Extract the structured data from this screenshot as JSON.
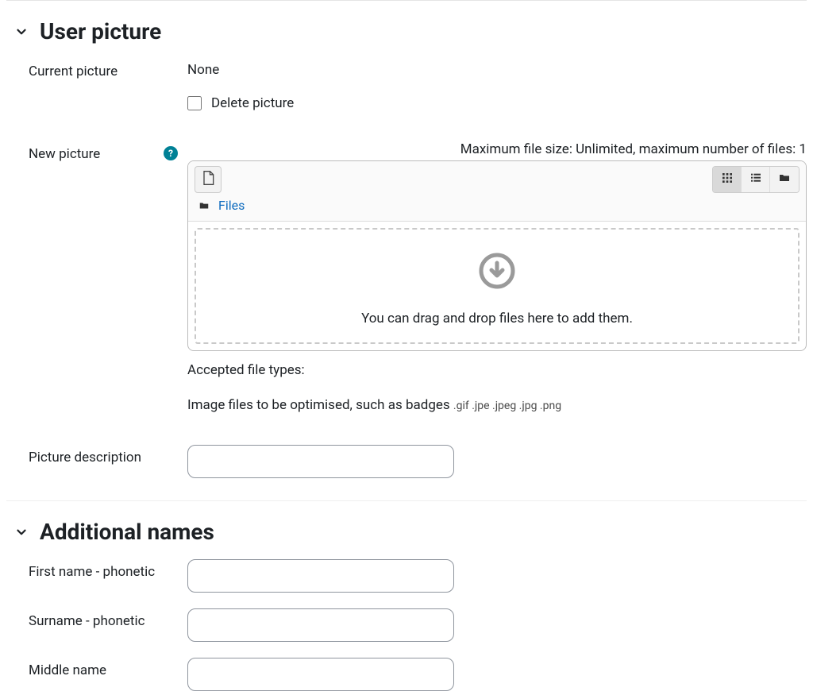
{
  "userPicture": {
    "sectionTitle": "User picture",
    "currentPicture": {
      "label": "Current picture",
      "value": "None"
    },
    "deletePicture": {
      "label": "Delete picture"
    },
    "newPicture": {
      "label": "New picture",
      "maxHint": "Maximum file size: Unlimited, maximum number of files: 1",
      "pathLabel": "Files",
      "dropText": "You can drag and drop files here to add them.",
      "acceptedLabel": "Accepted file types:",
      "acceptedDesc": "Image files to be optimised, such as badges ",
      "acceptedExts": ".gif .jpe .jpeg .jpg .png"
    },
    "pictureDescription": {
      "label": "Picture description",
      "value": ""
    }
  },
  "additionalNames": {
    "sectionTitle": "Additional names",
    "firstNamePhonetic": {
      "label": "First name - phonetic",
      "value": ""
    },
    "surnamePhonetic": {
      "label": "Surname - phonetic",
      "value": ""
    },
    "middleName": {
      "label": "Middle name",
      "value": ""
    }
  }
}
